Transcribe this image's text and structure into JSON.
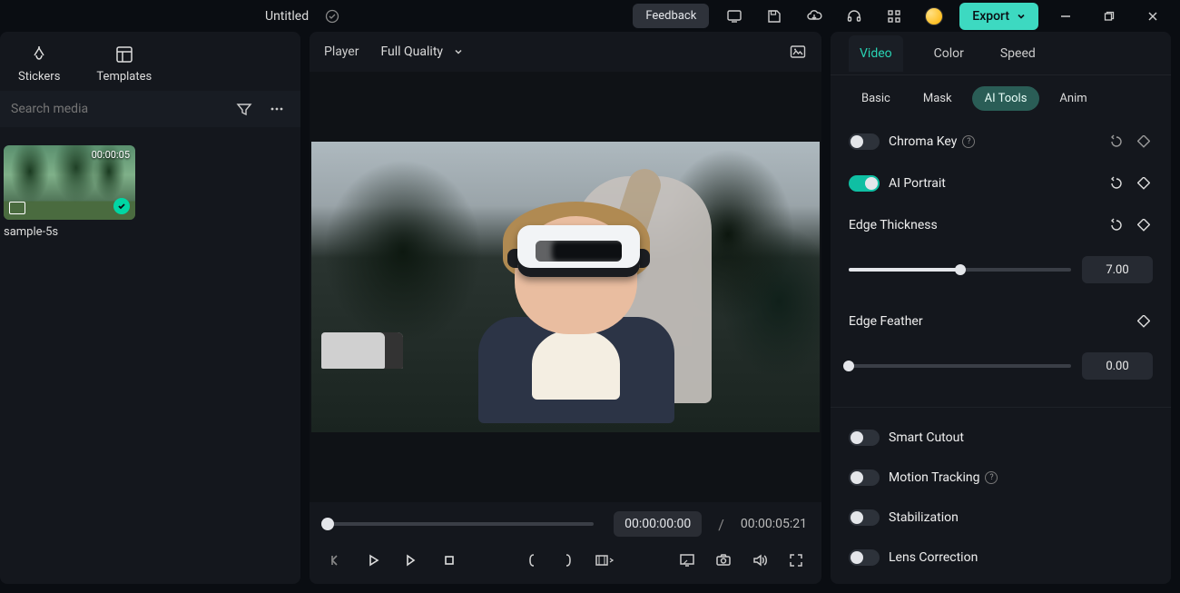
{
  "topbar": {
    "title": "Untitled",
    "feedback": "Feedback",
    "export": "Export"
  },
  "left": {
    "tabs": {
      "stickers": "Stickers",
      "templates": "Templates"
    },
    "search_placeholder": "Search media",
    "media": {
      "duration": "00:00:05",
      "name": "sample-5s"
    }
  },
  "player": {
    "label": "Player",
    "quality": "Full Quality",
    "time_current": "00:00:00:00",
    "time_sep": "/",
    "time_total": "00:00:05:21"
  },
  "right": {
    "tabs": {
      "video": "Video",
      "color": "Color",
      "speed": "Speed"
    },
    "subtabs": {
      "basic": "Basic",
      "mask": "Mask",
      "aitools": "AI Tools",
      "anim": "Anim"
    },
    "props": {
      "chroma_key": "Chroma Key",
      "ai_portrait": "AI Portrait",
      "edge_thickness": "Edge Thickness",
      "edge_thickness_val": "7.00",
      "edge_feather": "Edge Feather",
      "edge_feather_val": "0.00",
      "smart_cutout": "Smart Cutout",
      "motion_tracking": "Motion Tracking",
      "stabilization": "Stabilization",
      "lens_correction": "Lens Correction"
    }
  }
}
